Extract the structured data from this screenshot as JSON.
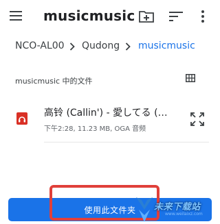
{
  "appbar": {
    "title": "musicmusic",
    "menu_icon": "hamburger-menu-icon",
    "new_folder_icon": "create-new-folder-icon",
    "sort_icon": "sort-icon",
    "more_icon": "more-vert-icon"
  },
  "breadcrumb": {
    "items": [
      "NCO-AL00",
      "Qudong",
      "musicmusic"
    ],
    "separator_icon": "chevron-right-icon",
    "active_color": "#1a73e8"
  },
  "section": {
    "title": "musicmusic 中的文件",
    "view_icon": "grid-view-icon"
  },
  "files": [
    {
      "name": "高铃 (Callin') - 愛してる (…",
      "meta": "下午2:28, 11.23 MB, OGA 音频",
      "icon": "audio-file-icon",
      "icon_color": "#d93025",
      "action_icon": "fullscreen-expand-icon"
    }
  ],
  "bottom": {
    "button_label": "使用此文件夹",
    "button_color": "#1a73e8",
    "highlight_color": "#e0403a"
  },
  "watermark": {
    "text": "未来下载站",
    "url": "www.weilaixz.com"
  }
}
